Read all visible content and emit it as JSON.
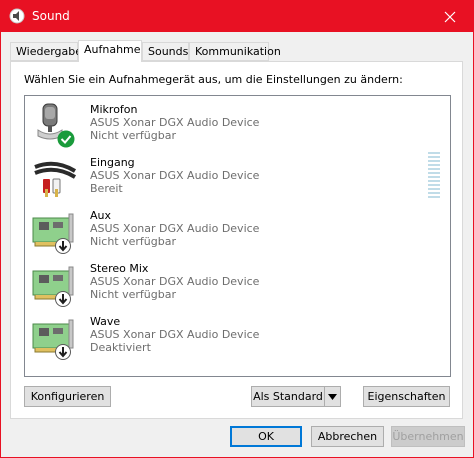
{
  "window": {
    "title": "Sound",
    "accent": "#e81123"
  },
  "tabs": [
    {
      "label": "Wiedergabe",
      "active": false
    },
    {
      "label": "Aufnahme",
      "active": true
    },
    {
      "label": "Sounds",
      "active": false
    },
    {
      "label": "Kommunikation",
      "active": false
    }
  ],
  "instruction": "Wählen Sie ein Aufnahmegerät aus, um die Einstellungen zu ändern:",
  "devices": [
    {
      "name": "Mikrofon",
      "description": "ASUS Xonar DGX Audio Device",
      "state": "Nicht verfügbar",
      "icon": "microphone-icon",
      "badge": "check-badge-icon"
    },
    {
      "name": "Eingang",
      "description": "ASUS Xonar DGX Audio Device",
      "state": "Bereit",
      "icon": "rca-cable-icon",
      "badge": ""
    },
    {
      "name": "Aux",
      "description": "ASUS Xonar DGX Audio Device",
      "state": "Nicht verfügbar",
      "icon": "sound-card-icon",
      "badge": "down-arrow-badge-icon"
    },
    {
      "name": "Stereo Mix",
      "description": "ASUS Xonar DGX Audio Device",
      "state": "Nicht verfügbar",
      "icon": "sound-card-icon",
      "badge": "down-arrow-badge-icon"
    },
    {
      "name": "Wave",
      "description": "ASUS Xonar DGX Audio Device",
      "state": "Deaktiviert",
      "icon": "sound-card-icon",
      "badge": "down-arrow-badge-icon"
    }
  ],
  "panel_buttons": {
    "configure": "Konfigurieren",
    "set_default": "Als Standard",
    "properties": "Eigenschaften"
  },
  "dialog_buttons": {
    "ok": "OK",
    "cancel": "Abbrechen",
    "apply": "Übernehmen"
  }
}
